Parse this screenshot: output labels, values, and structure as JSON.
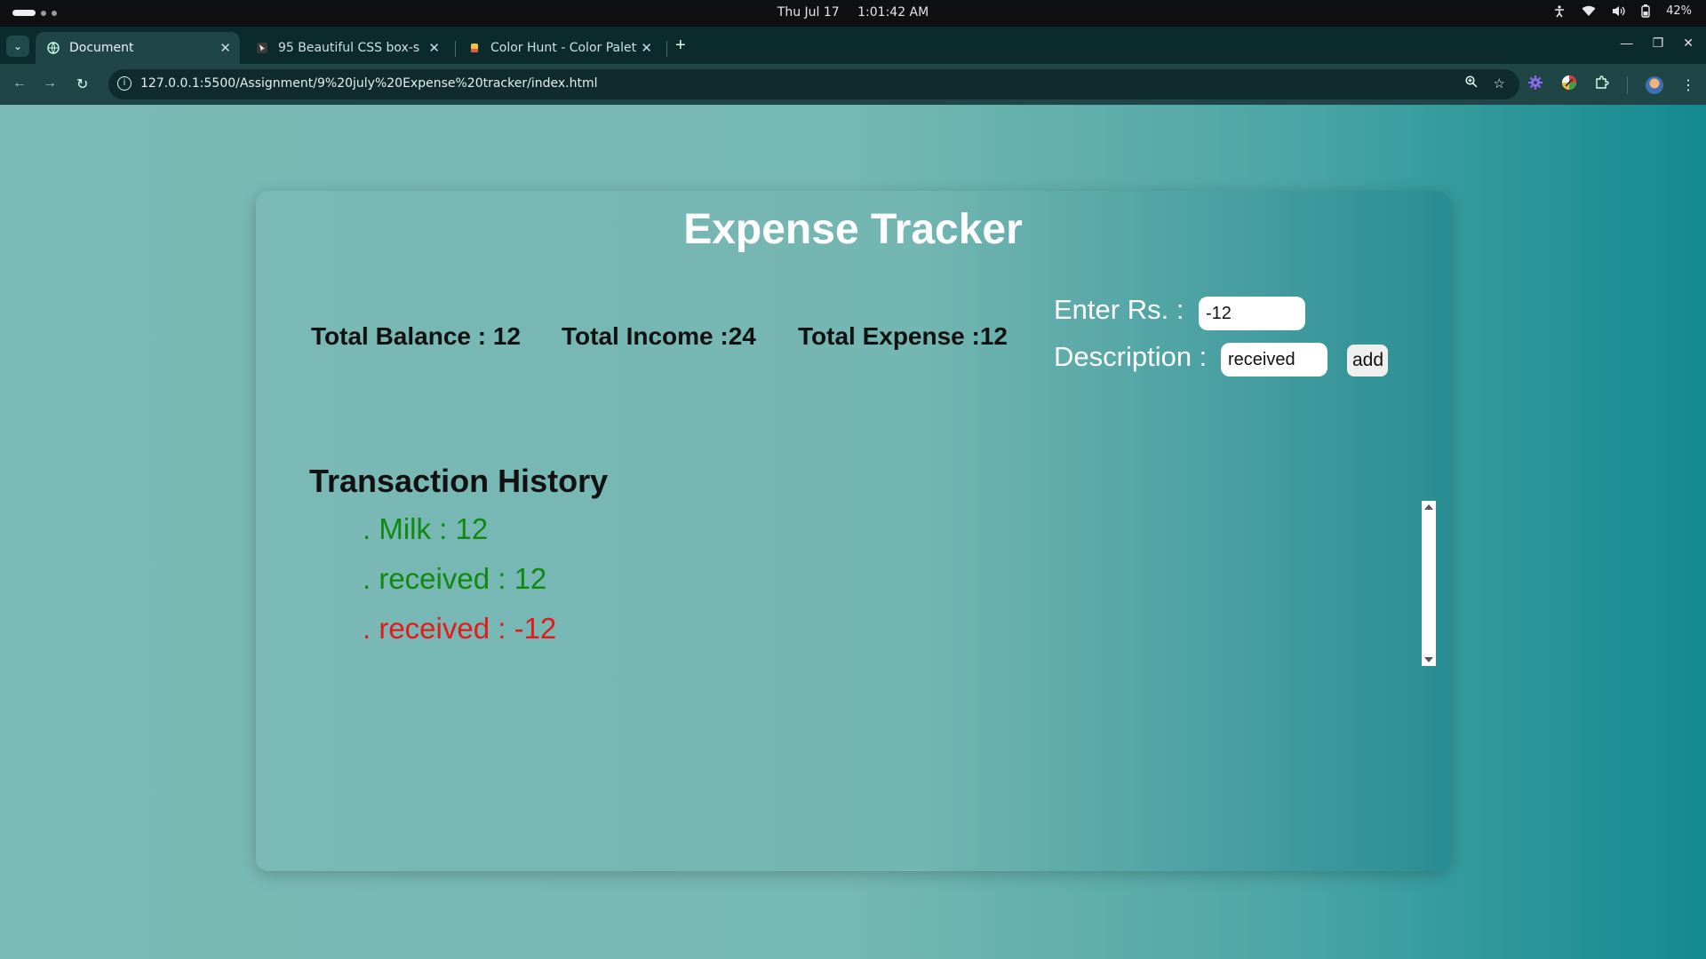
{
  "os": {
    "date": "Thu Jul 17",
    "time": "1:01:42 AM",
    "battery": "42%"
  },
  "browser": {
    "tabs": [
      {
        "title": "Document",
        "active": true,
        "icon": "globe-icon"
      },
      {
        "title": "95 Beautiful CSS box-sha",
        "active": false,
        "icon": "cursor-icon"
      },
      {
        "title": "Color Hunt - Color Palett",
        "active": false,
        "icon": "color-hunt-icon"
      }
    ],
    "url": "127.0.0.1:5500/Assignment/9%20july%20Expense%20tracker/index.html"
  },
  "app": {
    "title": "Expense Tracker",
    "totals": {
      "balance": "Total Balance : 12",
      "income": "Total Income :24",
      "expense": "Total Expense :12"
    },
    "form": {
      "amount_label": "Enter Rs. :",
      "amount_value": "-12",
      "description_label": "Description :",
      "description_value": "received",
      "add_label": "add"
    },
    "history": {
      "title": "Transaction History",
      "items": [
        {
          "text": ". Milk : 12",
          "color": "#0f8a0f"
        },
        {
          "text": ". received : 12",
          "color": "#0f8a0f"
        },
        {
          "text": ". received : -12",
          "color": "#e51a1a"
        }
      ]
    }
  }
}
